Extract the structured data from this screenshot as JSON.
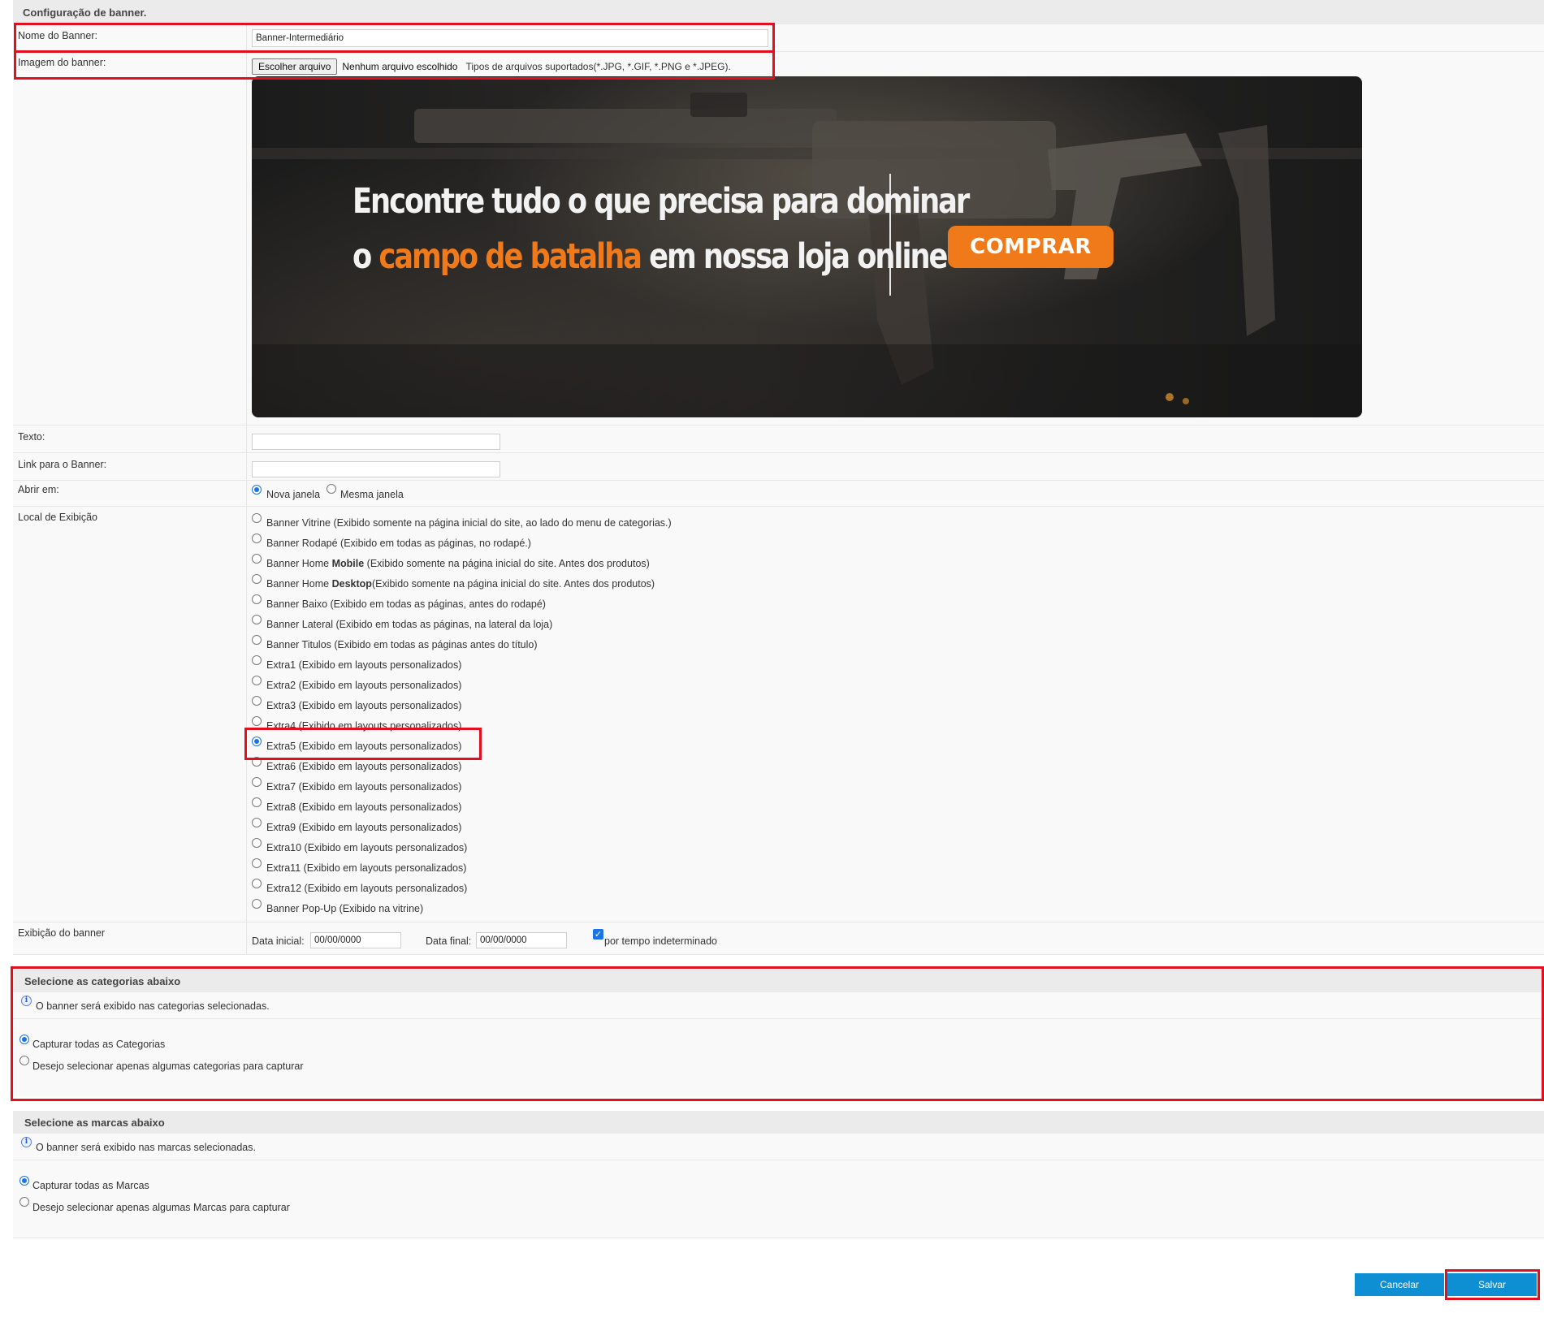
{
  "banner_config": {
    "title": "Configuração de banner.",
    "nome_label": "Nome do Banner:",
    "nome_value": "Banner-Intermediário",
    "imagem_label": "Imagem do banner:",
    "file_button": "Escolher arquivo",
    "file_none": "Nenhum arquivo escolhido",
    "file_types": "Tipos de arquivos suportados(*.JPG, *.GIF, *.PNG e *.JPEG).",
    "banner_image": {
      "line1": "Encontre tudo o que precisa para dominar",
      "line2_prefix": "o",
      "line2_highlight": "campo de batalha",
      "line2_suffix": "em nossa loja online",
      "cta": "COMPRAR",
      "highlight_color": "#f07a1a"
    },
    "texto_label": "Texto:",
    "texto_value": "",
    "link_label": "Link para o Banner:",
    "link_value": "",
    "abrir_label": "Abrir em:",
    "abrir_options": [
      "Nova janela",
      "Mesma janela"
    ],
    "abrir_selected": "Nova janela",
    "local_label": "Local de Exibição",
    "local_options": [
      {
        "pre": "Banner Vitrine (Exibido somente na página inicial do site, ao lado do menu de categorias.)",
        "bold": "",
        "post": "",
        "checked": false
      },
      {
        "pre": "Banner Rodapé (Exibido em todas as páginas, no rodapé.)",
        "bold": "",
        "post": "",
        "checked": false
      },
      {
        "pre": "Banner Home ",
        "bold": "Mobile",
        "post": " (Exibido somente na página inicial do site. Antes dos produtos)",
        "checked": false
      },
      {
        "pre": "Banner Home ",
        "bold": "Desktop",
        "post": "(Exibido somente na página inicial do site. Antes dos produtos)",
        "checked": false
      },
      {
        "pre": "Banner Baixo (Exibido em todas as páginas, antes do rodapé)",
        "bold": "",
        "post": "",
        "checked": false
      },
      {
        "pre": "Banner Lateral (Exibido em todas as páginas, na lateral da loja)",
        "bold": "",
        "post": "",
        "checked": false
      },
      {
        "pre": "Banner Titulos (Exibido em todas as páginas antes do título)",
        "bold": "",
        "post": "",
        "checked": false
      },
      {
        "pre": "Extra1 (Exibido em layouts personalizados)",
        "bold": "",
        "post": "",
        "checked": false
      },
      {
        "pre": "Extra2 (Exibido em layouts personalizados)",
        "bold": "",
        "post": "",
        "checked": false
      },
      {
        "pre": "Extra3 (Exibido em layouts personalizados)",
        "bold": "",
        "post": "",
        "checked": false
      },
      {
        "pre": "Extra4 (Exibido em layouts personalizados)",
        "bold": "",
        "post": "",
        "checked": false
      },
      {
        "pre": "Extra5 (Exibido em layouts personalizados)",
        "bold": "",
        "post": "",
        "checked": true
      },
      {
        "pre": "Extra6 (Exibido em layouts personalizados)",
        "bold": "",
        "post": "",
        "checked": false
      },
      {
        "pre": "Extra7 (Exibido em layouts personalizados)",
        "bold": "",
        "post": "",
        "checked": false
      },
      {
        "pre": "Extra8 (Exibido em layouts personalizados)",
        "bold": "",
        "post": "",
        "checked": false
      },
      {
        "pre": "Extra9 (Exibido em layouts personalizados)",
        "bold": "",
        "post": "",
        "checked": false
      },
      {
        "pre": "Extra10 (Exibido em layouts personalizados)",
        "bold": "",
        "post": "",
        "checked": false
      },
      {
        "pre": "Extra11 (Exibido em layouts personalizados)",
        "bold": "",
        "post": "",
        "checked": false
      },
      {
        "pre": "Extra12 (Exibido em layouts personalizados)",
        "bold": "",
        "post": "",
        "checked": false
      },
      {
        "pre": "Banner Pop-Up (Exibido na vitrine)",
        "bold": "",
        "post": "",
        "checked": false
      }
    ],
    "exibicao_label": "Exibição do banner",
    "data_inicial_label": "Data inicial:",
    "data_inicial_value": "00/00/0000",
    "data_final_label": "Data final:",
    "data_final_value": "00/00/0000",
    "indeterminado_label": "por tempo indeterminado",
    "indeterminado_checked": true
  },
  "categorias": {
    "title": "Selecione as categorias abaixo",
    "info": "O banner será exibido nas categorias selecionadas.",
    "options": [
      "Capturar todas as Categorias",
      "Desejo selecionar apenas algumas categorias para capturar"
    ],
    "selected_index": 0
  },
  "marcas": {
    "title": "Selecione as marcas abaixo",
    "info": "O banner será exibido nas marcas selecionadas.",
    "options": [
      "Capturar todas as Marcas",
      "Desejo selecionar apenas algumas Marcas para capturar"
    ],
    "selected_index": 0
  },
  "actions": {
    "cancel_label": "Cancelar",
    "save_label": "Salvar"
  },
  "colors": {
    "button_blue": "#0e8ed3",
    "highlight_red": "#e2101f",
    "radio_blue": "#1a73e8"
  }
}
